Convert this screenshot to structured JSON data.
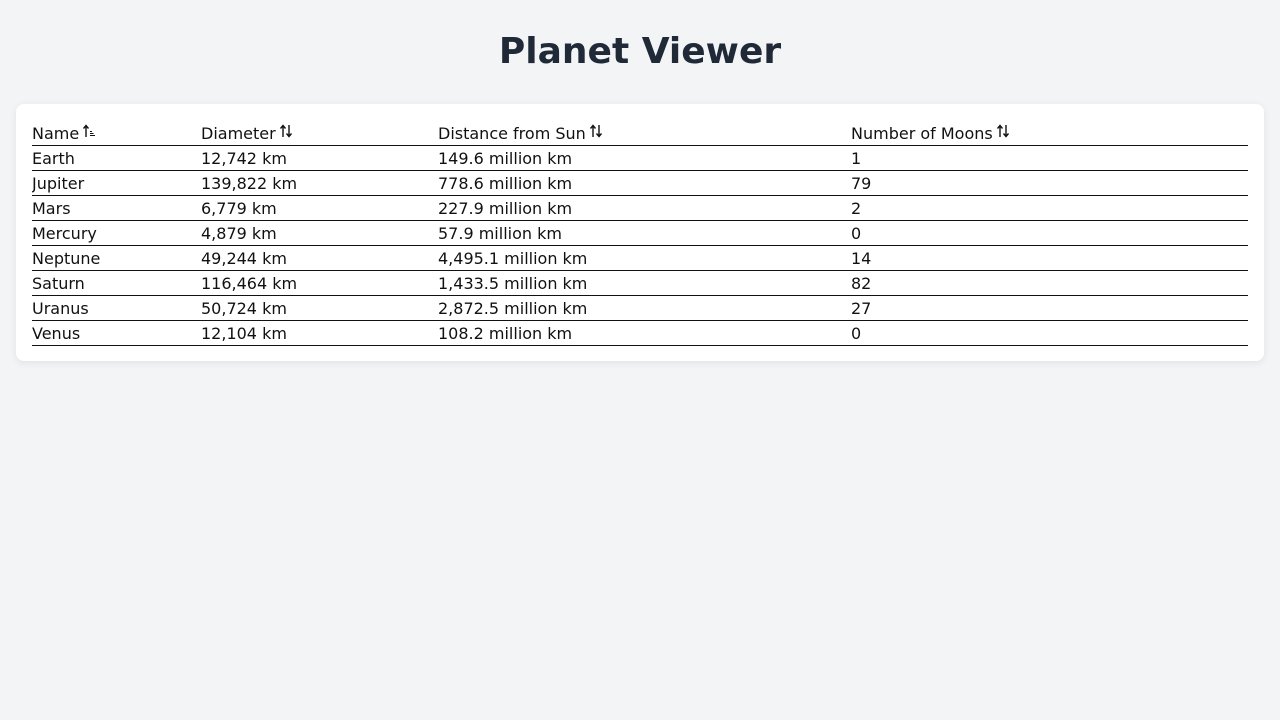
{
  "page": {
    "title": "Planet Viewer"
  },
  "table": {
    "columns": [
      {
        "label": "Name",
        "sort_icon": "sort-ascending-icon"
      },
      {
        "label": "Diameter",
        "sort_icon": "sort-icon"
      },
      {
        "label": "Distance from Sun",
        "sort_icon": "sort-icon"
      },
      {
        "label": "Number of Moons",
        "sort_icon": "sort-icon"
      }
    ],
    "rows": [
      [
        "Earth",
        "12,742 km",
        "149.6 million km",
        "1"
      ],
      [
        "Jupiter",
        "139,822 km",
        "778.6 million km",
        "79"
      ],
      [
        "Mars",
        "6,779 km",
        "227.9 million km",
        "2"
      ],
      [
        "Mercury",
        "4,879 km",
        "57.9 million km",
        "0"
      ],
      [
        "Neptune",
        "49,244 km",
        "4,495.1 million km",
        "14"
      ],
      [
        "Saturn",
        "116,464 km",
        "1,433.5 million km",
        "82"
      ],
      [
        "Uranus",
        "50,724 km",
        "2,872.5 million km",
        "27"
      ],
      [
        "Venus",
        "12,104 km",
        "108.2 million km",
        "0"
      ]
    ]
  },
  "colors": {
    "background": "#f3f4f6",
    "title": "#1f2937",
    "card": "#ffffff",
    "rule": "#111111"
  }
}
